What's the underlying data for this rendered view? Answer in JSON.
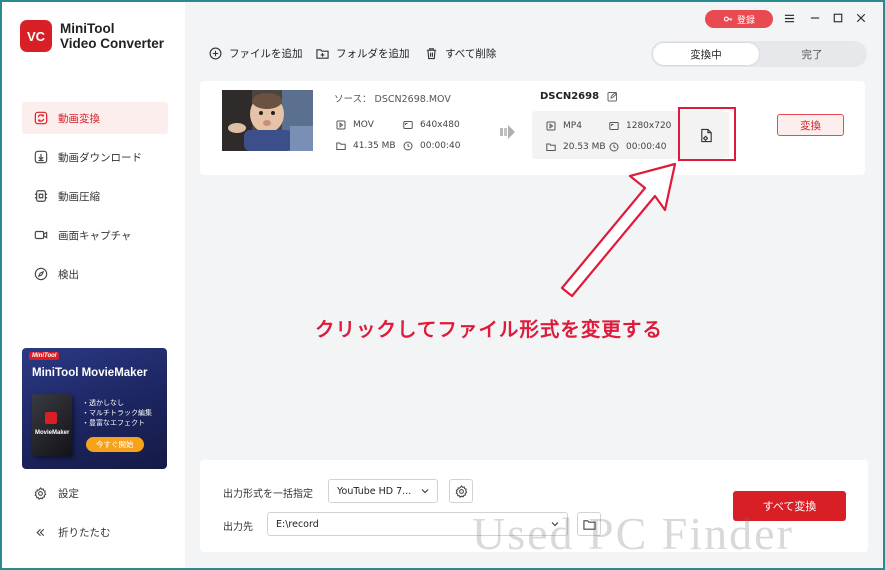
{
  "app": {
    "logo_mark": "VC",
    "name_line1": "MiniTool",
    "name_line2": "Video Converter"
  },
  "sidebar": {
    "items": [
      {
        "label": "動画変換",
        "icon": "convert-icon",
        "active": true
      },
      {
        "label": "動画ダウンロード",
        "icon": "download-icon",
        "active": false
      },
      {
        "label": "動画圧縮",
        "icon": "compress-icon",
        "active": false
      },
      {
        "label": "画面キャプチャ",
        "icon": "camera-icon",
        "active": false
      },
      {
        "label": "検出",
        "icon": "compass-icon",
        "active": false
      }
    ],
    "settings_label": "設定",
    "collapse_label": "折りたたむ"
  },
  "promo": {
    "tag": "MiniTool",
    "title": "MiniTool MovieMaker",
    "box_label": "MovieMaker",
    "features": [
      "・透かしなし",
      "・マルチトラック編集",
      "・豊富なエフェクト"
    ],
    "button": "今すぐ開始"
  },
  "header": {
    "register_label": "登録",
    "add_file": "ファイルを追加",
    "add_folder": "フォルダを追加",
    "delete_all": "すべて削除",
    "tab_converting": "変換中",
    "tab_done": "完了"
  },
  "item": {
    "source_label": "ソース：  DSCN2698.MOV",
    "src_format": "MOV",
    "src_resolution": "640x480",
    "src_size": "41.35 MB",
    "src_duration": "00:00:40",
    "target_name": "DSCN2698",
    "dst_format": "MP4",
    "dst_resolution": "1280x720",
    "dst_size": "20.53 MB",
    "dst_duration": "00:00:40",
    "convert_label": "変換"
  },
  "annotation": "クリックしてファイル形式を変更する",
  "footer": {
    "format_label": "出力形式を一括指定",
    "format_value": "YouTube HD 7...",
    "output_label": "出力先",
    "output_value": "E:\\record",
    "convert_all": "すべて変換"
  },
  "watermark": "Used PC Finder",
  "colors": {
    "brand_red": "#d81f26",
    "annotation_red": "#e01a3a",
    "register_pink": "#e94a52"
  }
}
